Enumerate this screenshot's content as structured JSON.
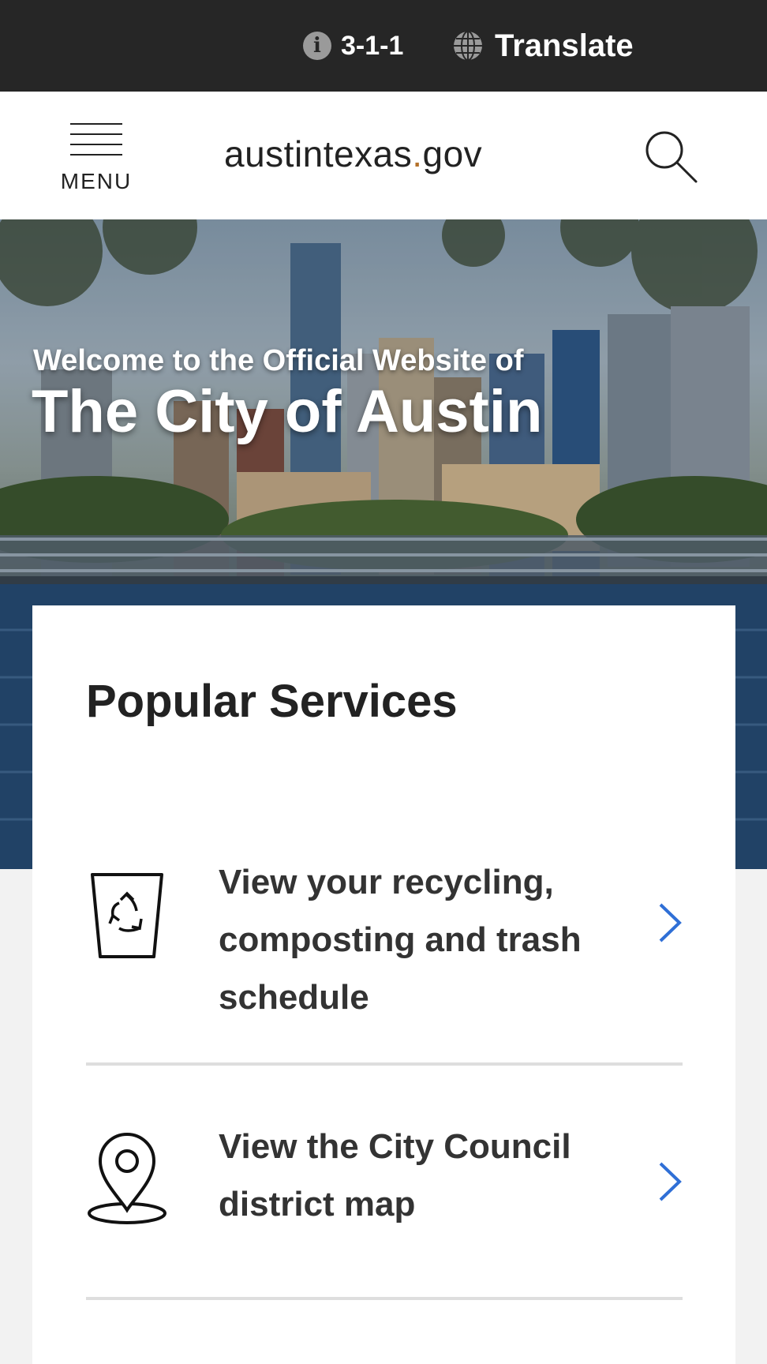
{
  "topbar": {
    "info_label": "3-1-1",
    "info_icon": "info-icon",
    "translate_label": "Translate",
    "translate_icon": "globe-icon"
  },
  "header": {
    "menu_label": "MENU",
    "logo_main": "austintexas",
    "logo_dot": ".",
    "logo_tld": "gov",
    "search_icon": "search-icon"
  },
  "hero": {
    "welcome": "Welcome to the Official Website of",
    "title": "The City of Austin"
  },
  "popular_services": {
    "heading": "Popular Services",
    "items": [
      {
        "label": "View your recycling, composting and trash schedule",
        "icon": "recycling-bin-icon"
      },
      {
        "label": "View the City Council district map",
        "icon": "map-pin-icon"
      }
    ]
  },
  "colors": {
    "topbar_bg": "#262626",
    "logo_dot": "#b3702a",
    "chevron": "#2f6fd6"
  }
}
